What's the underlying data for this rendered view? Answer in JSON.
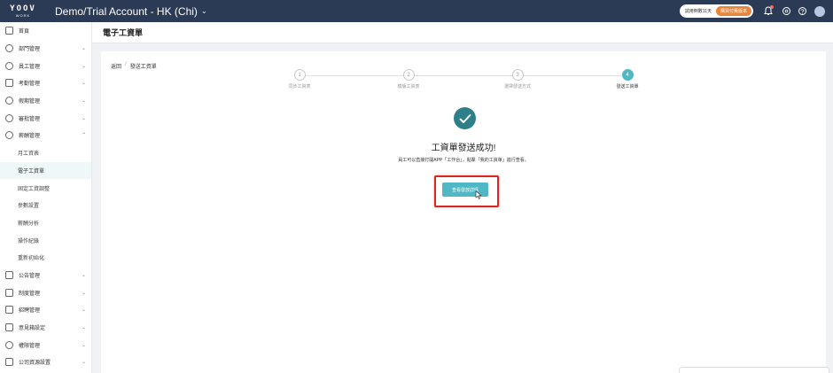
{
  "topbar": {
    "logo_line1": "YOOV",
    "logo_line2": "WORK",
    "account": "Demo/Trial Account - HK (Chi)",
    "account_chevron": "⌄",
    "trial_text": "試用倒數11天",
    "buy_button": "購買付費版本",
    "icons": [
      "bell-icon",
      "notice-icon",
      "help-icon",
      "avatar"
    ]
  },
  "sidebar": {
    "items": [
      {
        "label": "首頁",
        "icon": "home-icon"
      },
      {
        "label": "部門管理",
        "icon": "org-icon",
        "arrow": "⌄"
      },
      {
        "label": "員工管理",
        "icon": "people-icon",
        "arrow": "⌄"
      },
      {
        "label": "考勤管理",
        "icon": "calendar-icon",
        "arrow": "⌄"
      },
      {
        "label": "假期管理",
        "icon": "leave-icon",
        "arrow": "⌄"
      },
      {
        "label": "審批管理",
        "icon": "approval-icon",
        "arrow": "⌄"
      },
      {
        "label": "薪酬管理",
        "icon": "dollar-icon",
        "arrow": "⌃"
      }
    ],
    "sub_items": [
      "月工資表",
      "電子工資單",
      "固定工資調整",
      "參數設置",
      "薪酬分析",
      "操作紀錄",
      "重新初始化"
    ],
    "bottom_items": [
      {
        "label": "公告管理",
        "icon": "megaphone-icon",
        "arrow": "⌄"
      },
      {
        "label": "制度管理",
        "icon": "book-icon",
        "arrow": "⌄"
      },
      {
        "label": "招聘管理",
        "icon": "briefcase-icon",
        "arrow": "⌄"
      },
      {
        "label": "意見箱設定",
        "icon": "mailbox-icon",
        "arrow": "⌄"
      },
      {
        "label": "權限管理",
        "icon": "shield-icon",
        "arrow": "⌄"
      },
      {
        "label": "公司資源設置",
        "icon": "building-icon",
        "arrow": "⌄"
      }
    ]
  },
  "page": {
    "title": "電子工資單",
    "breadcrumb_back": "返回",
    "breadcrumb_sep": "/",
    "breadcrumb_current": "發送工資單"
  },
  "steps": [
    {
      "num": "1",
      "label": "同步工資表"
    },
    {
      "num": "2",
      "label": "模版工資表"
    },
    {
      "num": "3",
      "label": "選擇發送方式"
    },
    {
      "num": "4",
      "label": "發送工資單"
    }
  ],
  "result": {
    "title": "工資單發送成功!",
    "description": "員工可以直接打開APP「工作台」，點擊「我的工資單」進行查看。",
    "button": "查看發放詳情"
  },
  "colors": {
    "topbar": "#2b3a55",
    "accent": "#4fb8c4",
    "success": "#2d7f8a",
    "highlight": "#d9281f"
  }
}
